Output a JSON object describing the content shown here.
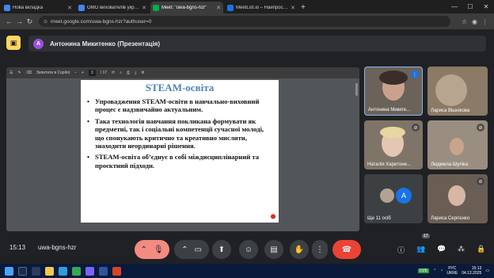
{
  "tabs": [
    {
      "label": "Нова вкладка",
      "icon": "chrome-icon",
      "color": "#4285f4",
      "active": false
    },
    {
      "label": "ОМО вихователів українські ...",
      "icon": "docs-icon",
      "color": "#4285f4",
      "active": false
    },
    {
      "label": "Meet: \"uwa-bgns-hzr\"",
      "icon": "meet-icon",
      "color": "#00ac47",
      "active": true
    },
    {
      "label": "MeetList.io – Найпростіший с...",
      "icon": "meetlist-icon",
      "color": "#1a73e8",
      "active": false
    }
  ],
  "url": "meet.google.com/uwa-bgns-hzr?authuser=0",
  "presenter": {
    "initial": "A",
    "label": "Антонина Микитенко (Презентація)"
  },
  "pdf_toolbar": {
    "page": "3",
    "total": "/ 17",
    "copilot": "Запитати в Copilot"
  },
  "slide": {
    "title": "STEAM-освіта",
    "bullets": [
      "Упровадження STEAM-освіти в навчально-виховний процес  є надзвичайно актуальним.",
      "Така технологія навчання покликана формувати як предметні, так і соціальні компетенції сучасної молоді, що спонукають критично та креативно мислити, знаходити неординарні рішення.",
      "STEAM-освіта об’єднує в собі міждисциплінарний та проєктний підходи."
    ]
  },
  "participants": [
    {
      "name": "Антонина Микиге...",
      "bg": "#6b6259"
    },
    {
      "name": "Лариса Вішнікова",
      "bg": "#8a7a66"
    },
    {
      "name": "Наталія Харитоне...",
      "bg": "#7f7468"
    },
    {
      "name": "Людмила Шуліка",
      "bg": "#9a8e80"
    },
    {
      "name": "Ще 11 осіб",
      "bg": "#3c4043"
    },
    {
      "name": "Лариса Сергієнко",
      "bg": "#6a5e54"
    }
  ],
  "more_avatar": "A",
  "bottom": {
    "time": "15:13",
    "code": "uwa-bgns-hzr",
    "people_count": "17"
  },
  "taskbar": {
    "lang1": "РУС",
    "lang2": "UKRE",
    "time": "15:13",
    "date": "04.12.2025",
    "tray_badge": "DZE"
  }
}
